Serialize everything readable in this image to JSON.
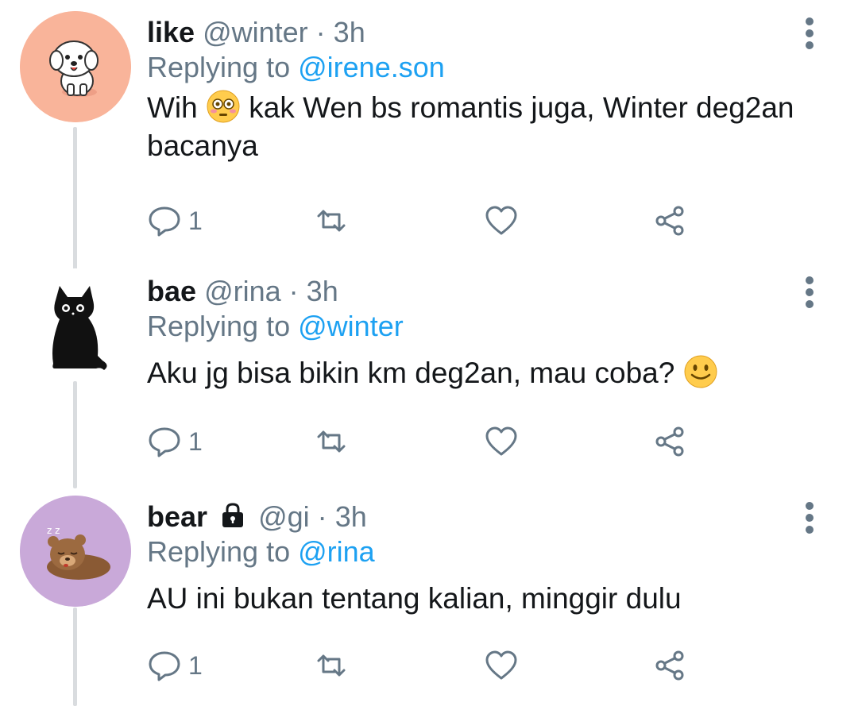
{
  "tweets": [
    {
      "name": "like",
      "handle": "@winter",
      "dot": "·",
      "time": "3h",
      "replying_prefix": "Replying to",
      "replying_to": "@irene.son",
      "text_before_emoji": "Wih",
      "emoji": "flushed-face",
      "text_after_emoji": "kak Wen bs romantis juga, Winter deg2an bacanya",
      "reply_count": "1",
      "avatar": "white-dog-avatar",
      "avatar_bg": "#f9b49a"
    },
    {
      "name": "bae",
      "handle": "@rina",
      "dot": "·",
      "time": "3h",
      "replying_prefix": "Replying to",
      "replying_to": "@winter",
      "text": "Aku jg bisa bikin km deg2an, mau coba?",
      "emoji": "smiling-face",
      "reply_count": "1",
      "avatar": "black-cat-avatar",
      "avatar_bg": "#ffffff"
    },
    {
      "name": "bear",
      "name_icon": "lock-icon",
      "handle": "@gi",
      "dot": "·",
      "time": "3h",
      "replying_prefix": "Replying to",
      "replying_to": "@rina",
      "text": "AU ini bukan tentang kalian, minggir dulu",
      "reply_count": "1",
      "avatar": "sleeping-bear-avatar",
      "avatar_bg": "#c9a9d9"
    }
  ],
  "colors": {
    "accent": "#1da1f2",
    "secondary_text": "#657786",
    "thread_line": "#d9dcdf"
  },
  "icons": {
    "reply": "reply-icon",
    "retweet": "retweet-icon",
    "like": "heart-icon",
    "share": "share-icon",
    "more": "more-vertical-icon"
  }
}
